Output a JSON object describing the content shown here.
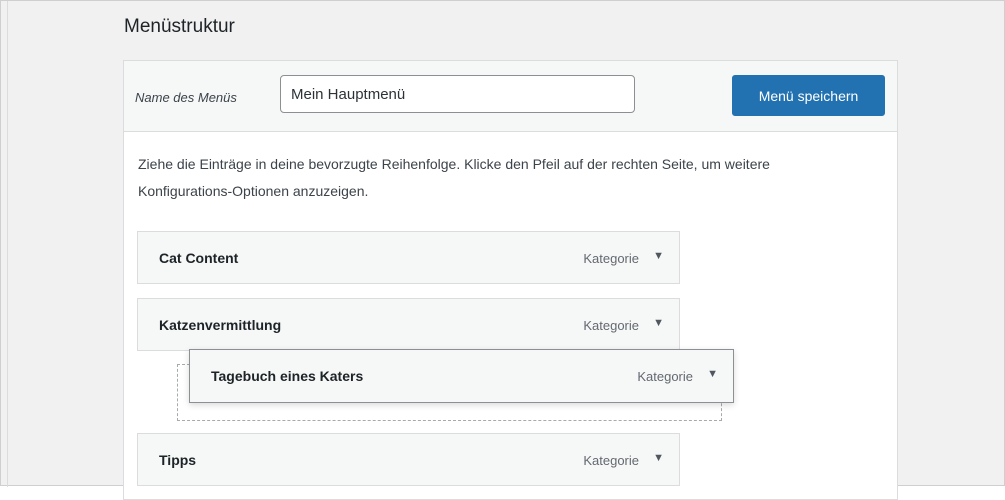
{
  "section": {
    "title": "Menüstruktur"
  },
  "menu_name": {
    "label": "Name des Menüs",
    "value": "Mein Hauptmenü"
  },
  "save_button": {
    "label": "Menü speichern"
  },
  "instructions": "Ziehe die Einträge in deine bevorzugte Reihenfolge. Klicke den Pfeil auf der rechten Seite, um weitere Konfigurations-Optionen anzuzeigen.",
  "items": [
    {
      "title": "Cat Content",
      "type": "Kategorie",
      "arrow": "▼"
    },
    {
      "title": "Katzenvermittlung",
      "type": "Kategorie",
      "arrow": "▼"
    },
    {
      "title": "Tagebuch eines Katers",
      "type": "Kategorie",
      "arrow": "▼"
    },
    {
      "title": "Tipps",
      "type": "Kategorie",
      "arrow": "▼"
    }
  ],
  "colors": {
    "primary": "#2271b1",
    "item_bg": "#f6f7f7",
    "border": "#dcdcde"
  }
}
